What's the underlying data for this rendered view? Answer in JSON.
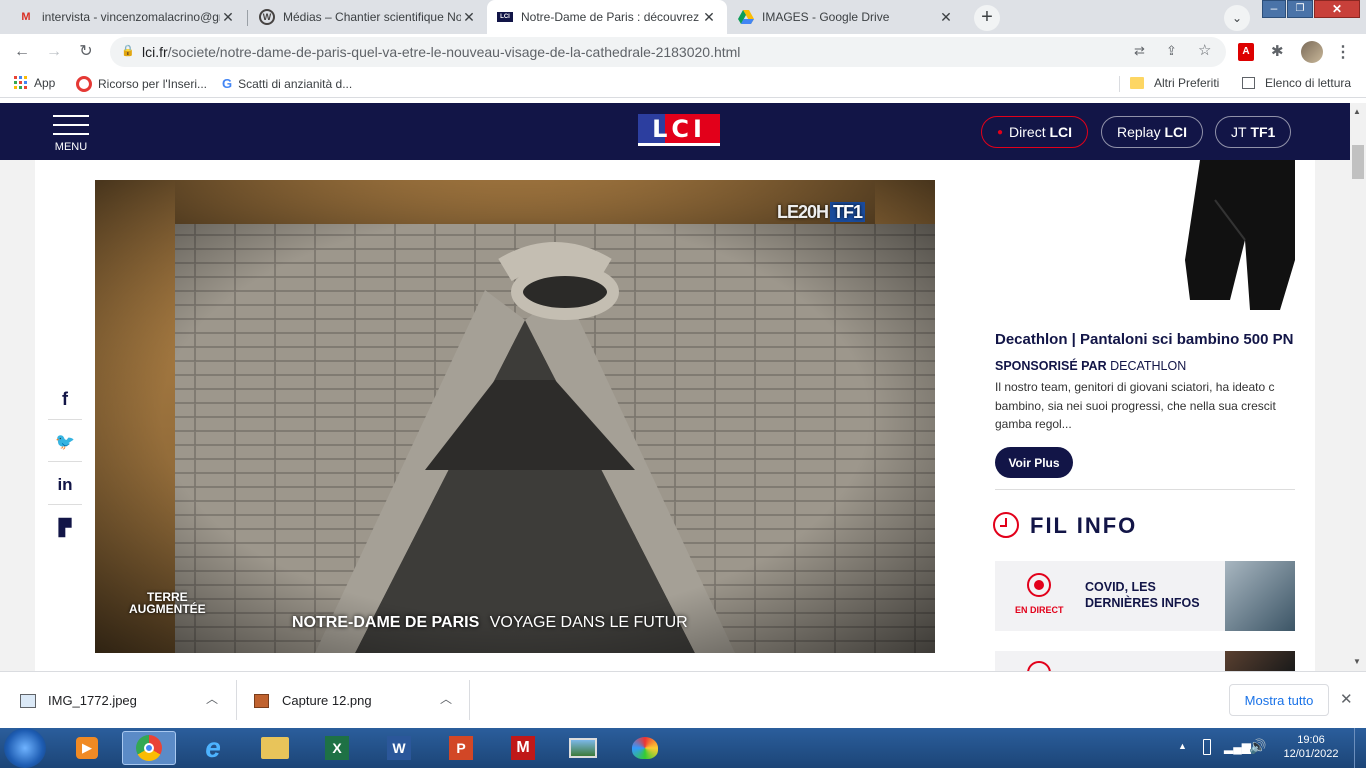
{
  "browser": {
    "tabs": [
      {
        "title": "intervista - vincenzomalacrino@gm",
        "favicon": "gmail-icon",
        "active": false
      },
      {
        "title": "Médias – Chantier scientifique Not",
        "favicon": "wordpress-icon",
        "active": false
      },
      {
        "title": "Notre-Dame de Paris : découvrez l",
        "favicon": "lci-icon",
        "active": true
      },
      {
        "title": "IMAGES - Google Drive",
        "favicon": "google-drive-icon",
        "active": false
      }
    ],
    "url_domain": "lci.fr",
    "url_path": "/societe/notre-dame-de-paris-quel-va-etre-le-nouveau-visage-de-la-cathedrale-2183020.html",
    "bookmarks": [
      {
        "label": "App",
        "icon": "apps-grid-icon"
      },
      {
        "label": "Ricorso per l'Inseri...",
        "icon": "target-icon"
      },
      {
        "label": "Scatti di anzianità d...",
        "icon": "google-icon"
      }
    ],
    "bookmarks_right": [
      {
        "label": "Altri Preferiti",
        "icon": "folder-icon"
      },
      {
        "label": "Elenco di lettura",
        "icon": "reading-list-icon"
      }
    ]
  },
  "site": {
    "menu_label": "MENU",
    "logo": "LCI",
    "nav": [
      {
        "prefix": "Direct",
        "bold": "LCI",
        "live": true
      },
      {
        "prefix": "Replay",
        "bold": "LCI",
        "live": false
      },
      {
        "prefix": "JT",
        "bold": "TF1",
        "live": false
      }
    ]
  },
  "video": {
    "channel_logo": "LE20H",
    "channel_logo_bold": "TF1",
    "badge_line1": "TERRE",
    "badge_line2": "AUGMENTÉE",
    "caption_title": "NOTRE-DAME DE PARIS",
    "caption_subtitle": "VOYAGE DANS LE FUTUR"
  },
  "ad": {
    "title": "Decathlon | Pantaloni sci bambino 500 PN",
    "sponsored_prefix": "SPONSORISÉ PAR",
    "sponsor": "DECATHLON",
    "text": "Il nostro team, genitori di giovani sciatori, ha ideato c bambino, sia nei suoi progressi, che nella sua crescit gamba regol...",
    "cta": "Voir Plus"
  },
  "fil_info": {
    "heading": "FIL INFO",
    "items": [
      {
        "badge": "EN DIRECT",
        "title": "COVID, LES DERNIÈRES INFOS"
      }
    ]
  },
  "downloads": {
    "items": [
      {
        "name": "IMG_1772.jpeg",
        "icon": "image-file-icon"
      },
      {
        "name": "Capture 12.png",
        "icon": "image-file-icon"
      }
    ],
    "show_all": "Mostra tutto"
  },
  "taskbar": {
    "time": "19:06",
    "date": "12/01/2022"
  },
  "colors": {
    "lci_navy": "#121547",
    "lci_red": "#e2001a",
    "chrome_tabstrip": "#dee1e6"
  }
}
